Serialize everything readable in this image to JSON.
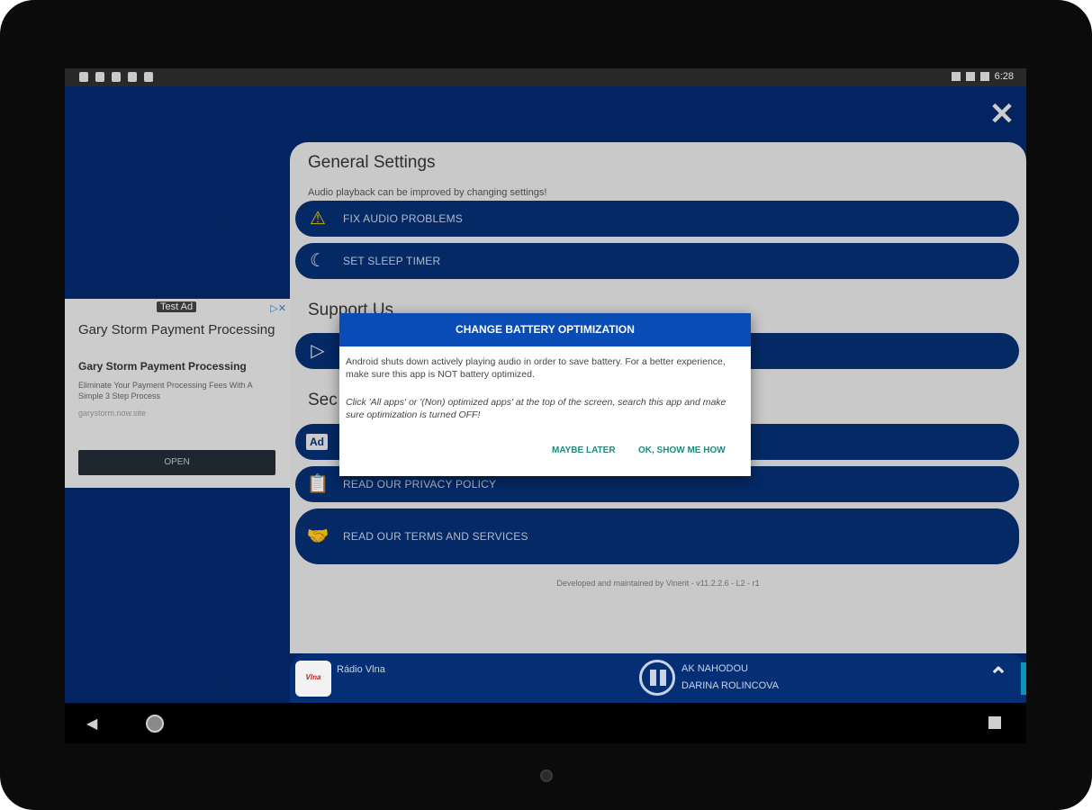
{
  "status_bar": {
    "time": "6:28"
  },
  "header": {
    "close_icon": "close-icon"
  },
  "general_settings": {
    "title": "General Settings",
    "subtitle": "Audio playback can be improved by changing settings!",
    "fix_audio_label": "FIX AUDIO PROBLEMS",
    "sleep_timer_label": "SET SLEEP TIMER"
  },
  "support": {
    "title": "Support Us"
  },
  "section3": {
    "title_partial": "Sec",
    "privacy_label": "READ OUR PRIVACY POLICY",
    "terms_label": "READ OUR TERMS AND SERVICES"
  },
  "footer_note": "Developed and maintained by Vinerit - v11.2.2.6 - L2 - r1",
  "ad": {
    "badge": "Test Ad",
    "title": "Gary Storm Payment Processing",
    "advertiser": "Gary Storm Payment Processing",
    "body": "Eliminate Your Payment Processing Fees With A Simple 3 Step Process",
    "url": "garystorm.now.site",
    "open_label": "OPEN",
    "icon_text": "Ad"
  },
  "dialog": {
    "title": "CHANGE BATTERY OPTIMIZATION",
    "paragraph1": "Android shuts down actively playing audio in order to save battery. For a better experience, make sure this app is NOT battery optimized.",
    "paragraph2": "Click 'All apps' or '(Non) optimized apps' at the top of the screen, search this app and make sure optimization is turned OFF!",
    "maybe_later_label": "MAYBE LATER",
    "show_me_label": "OK, SHOW ME HOW"
  },
  "player": {
    "station": "Rádio Vlna",
    "logo_text": "Vlna",
    "artist": "AK NAHODOU",
    "track": "DARINA ROLINCOVA"
  },
  "colors": {
    "app_bg": "#042a6e",
    "pill": "#052f74",
    "dialog_header": "#0a4cb5",
    "dialog_button": "#1f8a7d"
  }
}
